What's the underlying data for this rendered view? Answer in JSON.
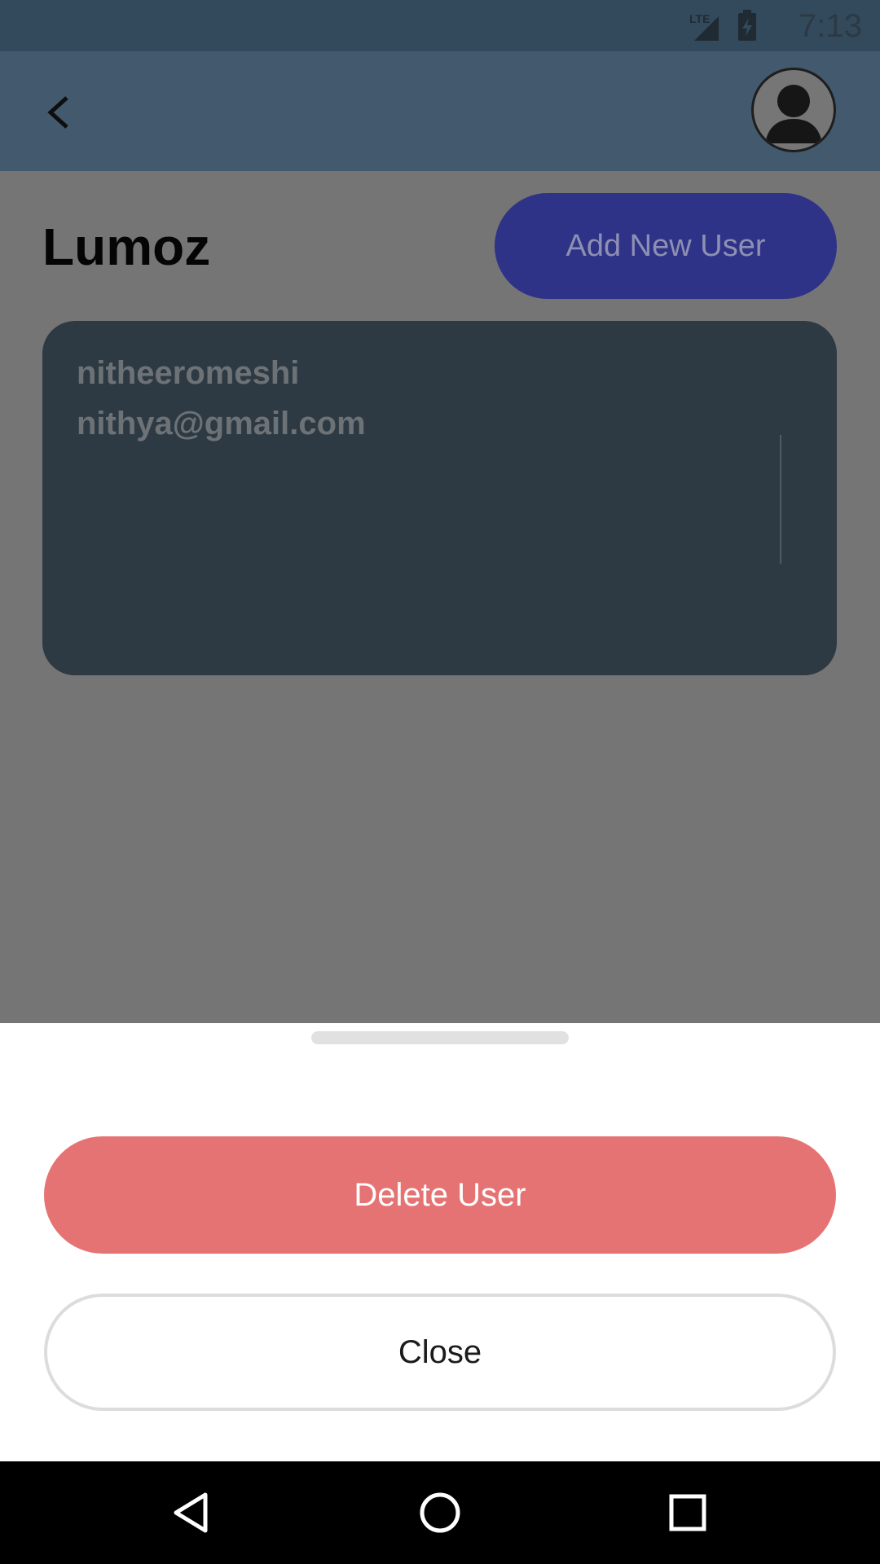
{
  "status_bar": {
    "time": "7:13",
    "network": "LTE",
    "icons": [
      "lte-signal-icon",
      "battery-charging-icon"
    ]
  },
  "app_bar": {
    "back_icon": "chevron-left-icon",
    "profile_icon": "account-circle-icon"
  },
  "main": {
    "title": "Lumoz",
    "add_user_label": "Add New User",
    "users": [
      {
        "name": "nitheeromeshi",
        "email": "nithya@gmail.com"
      }
    ]
  },
  "bottom_sheet": {
    "delete_label": "Delete User",
    "close_label": "Close"
  },
  "navigation": {
    "icons": [
      "nav-back-icon",
      "nav-home-icon",
      "nav-recents-icon"
    ]
  },
  "colors": {
    "app_bar": "#43596d",
    "scrim_background": "#757575",
    "primary_button": "#2f3387",
    "card": "#2e3a43",
    "danger": "#e57373"
  }
}
